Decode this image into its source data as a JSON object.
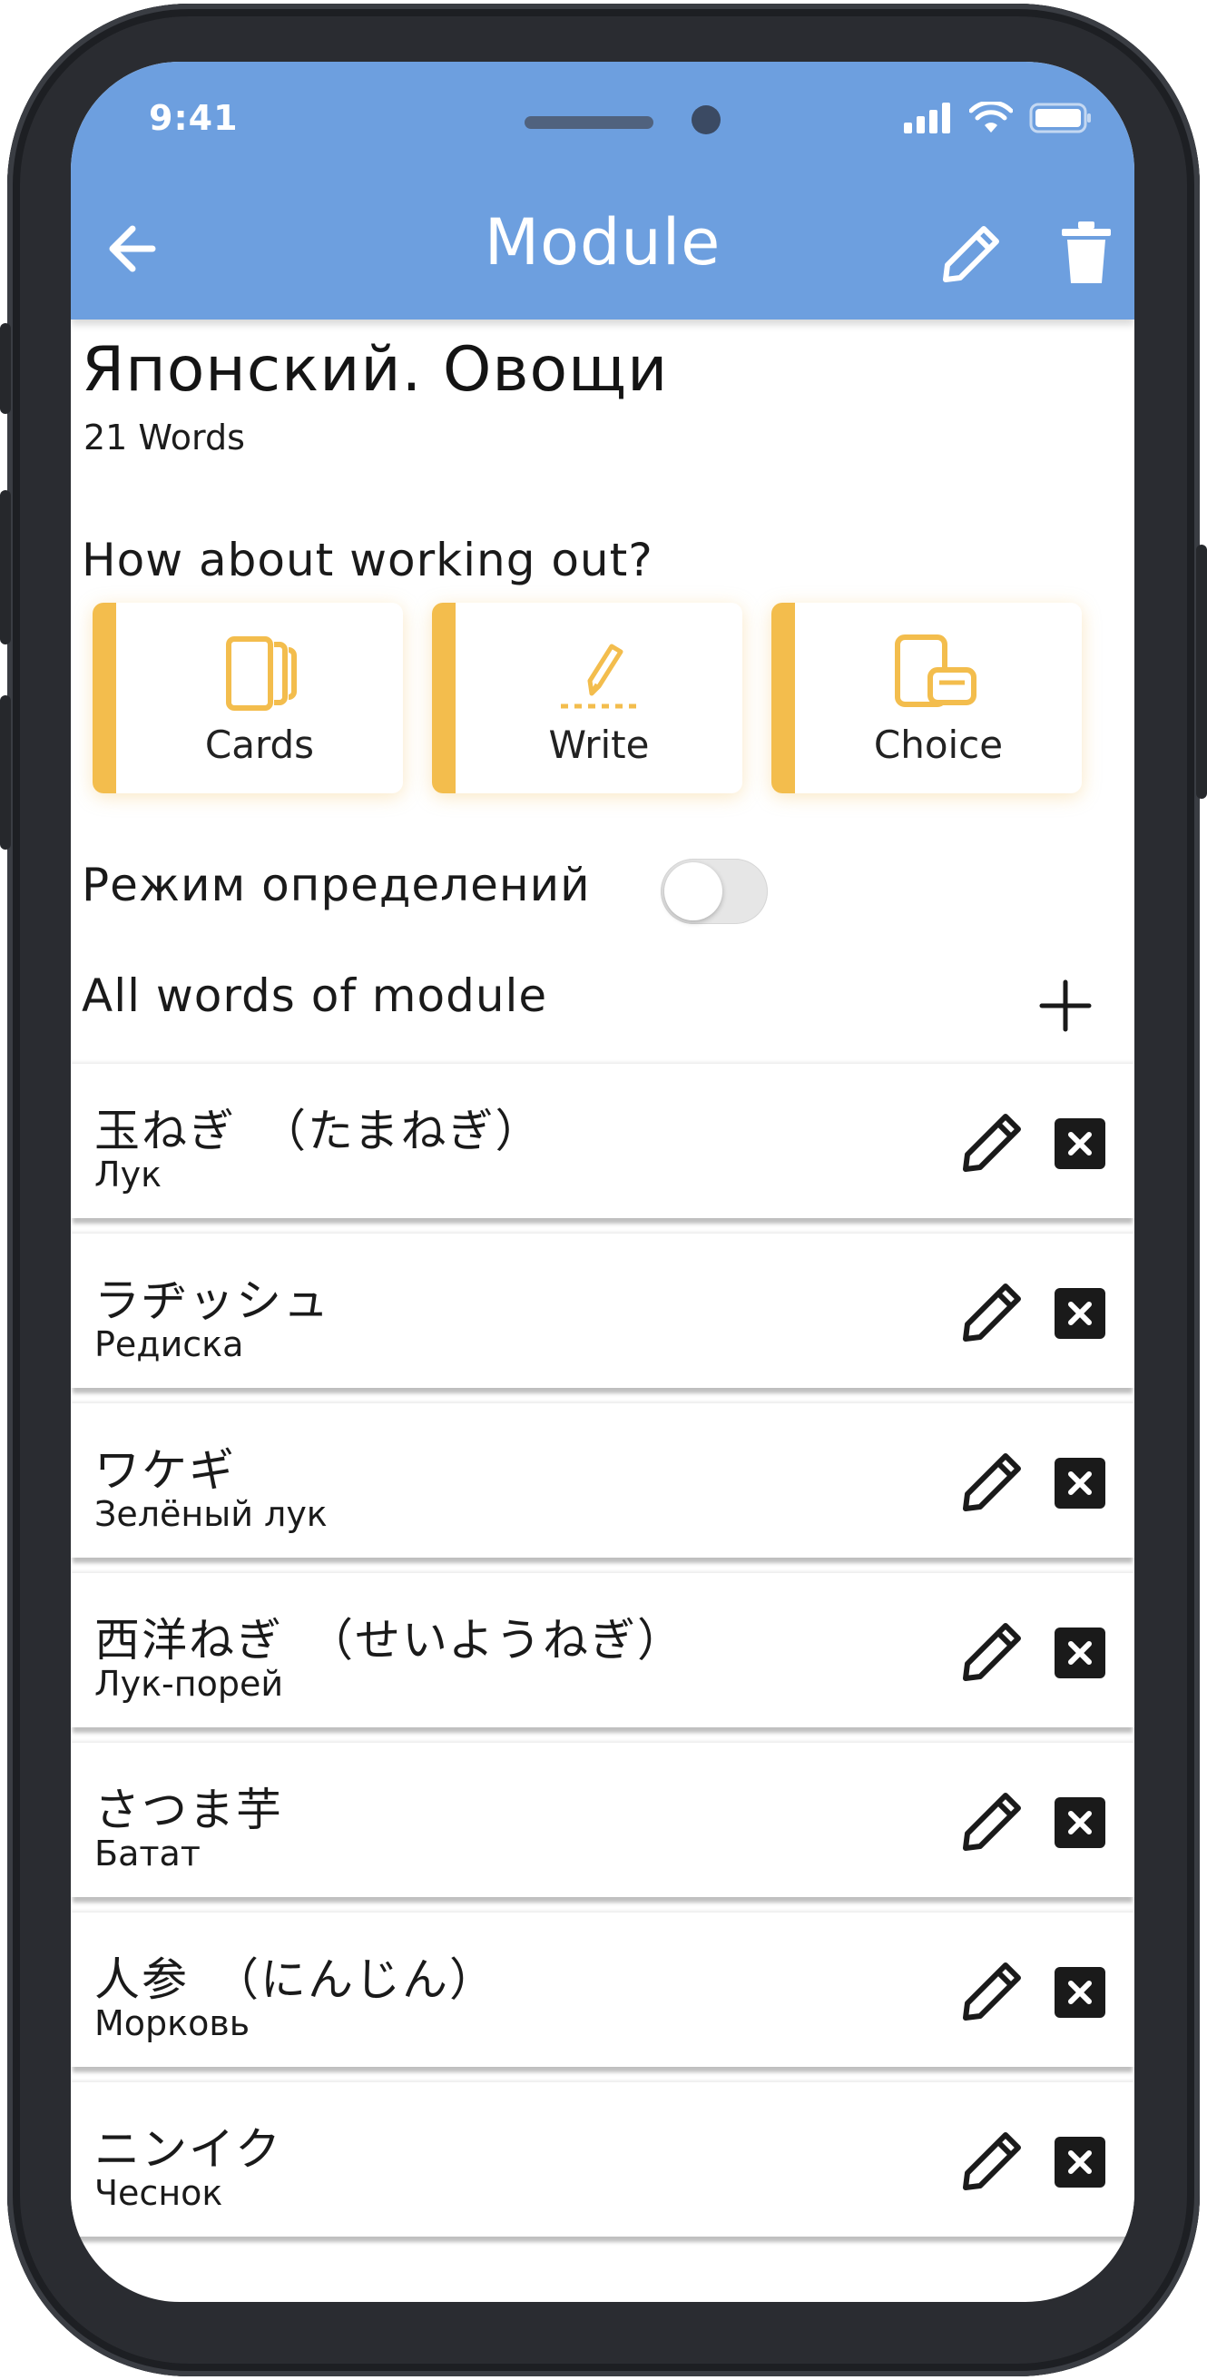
{
  "status_bar": {
    "time": "9:41"
  },
  "header": {
    "title": "Module",
    "back_icon": "arrow-left-icon",
    "edit_icon": "pencil-icon",
    "delete_icon": "trash-icon",
    "background_color": "#6d9fdf"
  },
  "module": {
    "title": "Японский. Овощи",
    "count": "21 Words"
  },
  "workout": {
    "question": "How about working out?",
    "modes": [
      {
        "label": "Cards",
        "icon": "cards-icon"
      },
      {
        "label": "Write",
        "icon": "write-pen-icon"
      },
      {
        "label": "Choice",
        "icon": "choice-icon"
      }
    ],
    "accent_color": "#f3bd4d"
  },
  "definition_mode": {
    "label": "Режим определений",
    "enabled": false
  },
  "words_section": {
    "label": "All words of module",
    "add_icon": "plus-icon"
  },
  "words": [
    {
      "term": "玉ねぎ　（たまねぎ）",
      "translation": "Лук"
    },
    {
      "term": "ラヂッシュ",
      "translation": "Редиска"
    },
    {
      "term": "ワケギ",
      "translation": "Зелёный лук"
    },
    {
      "term": "西洋ねぎ　（せいようねぎ）",
      "translation": "Лук-порей"
    },
    {
      "term": "さつま芋",
      "translation": "Батат"
    },
    {
      "term": "人参　（にんじん）",
      "translation": "Морковь"
    },
    {
      "term": "ニンイク",
      "translation": "Чеснок"
    }
  ]
}
